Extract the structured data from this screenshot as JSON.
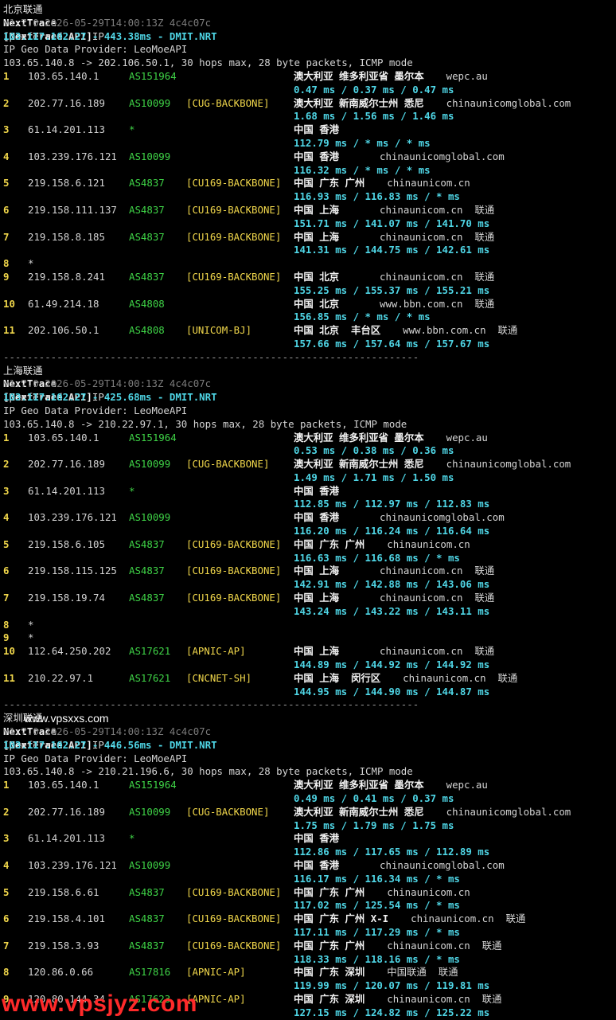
{
  "blocks": [
    {
      "title": "北京联通",
      "watermark": "",
      "version": "v1.7.0 2026-05-29T14:00:13Z 4c4c07c",
      "api_prefix": "[NextTrace API]",
      "api_mid": " preferred API IP - ",
      "api_ip": "103.117.102.27 - 443.38ms - DMIT.NRT",
      "provider": "IP Geo Data Provider: LeoMoeAPI",
      "route": "103.65.140.8 -> 202.106.50.1, 30 hops max, 28 byte packets, ICMP mode",
      "hops": [
        {
          "n": "1",
          "ip": "103.65.140.1",
          "as": "AS151964",
          "tag": "",
          "geo": "澳大利亚 维多利亚省 墨尔本",
          "dom": "wepc.au",
          "rtt": "0.47 ms / 0.37 ms / 0.47 ms"
        },
        {
          "n": "2",
          "ip": "202.77.16.189",
          "as": "AS10099",
          "tag": "[CUG-BACKBONE]",
          "geo": "澳大利亚 新南威尔士州 悉尼",
          "dom": "chinaunicomglobal.com",
          "rtt": "1.68 ms / 1.56 ms / 1.46 ms"
        },
        {
          "n": "3",
          "ip": "61.14.201.113",
          "as": "*",
          "tag": "",
          "geo": "中国 香港",
          "dom": "",
          "rtt": "112.79 ms / * ms / * ms"
        },
        {
          "n": "4",
          "ip": "103.239.176.121",
          "as": "AS10099",
          "tag": "",
          "geo": "中国 香港",
          "dom": "chinaunicomglobal.com",
          "rtt": "116.32 ms / * ms / * ms"
        },
        {
          "n": "5",
          "ip": "219.158.6.121",
          "as": "AS4837",
          "tag": "[CU169-BACKBONE]",
          "geo": "中国 广东 广州",
          "dom": "chinaunicom.cn",
          "rtt": "116.93 ms / 116.83 ms / * ms"
        },
        {
          "n": "6",
          "ip": "219.158.111.137",
          "as": "AS4837",
          "tag": "[CU169-BACKBONE]",
          "geo": "中国 上海",
          "dom": "chinaunicom.cn  联通",
          "rtt": "151.71 ms / 141.07 ms / 141.70 ms"
        },
        {
          "n": "7",
          "ip": "219.158.8.185",
          "as": "AS4837",
          "tag": "[CU169-BACKBONE]",
          "geo": "中国 上海",
          "dom": "chinaunicom.cn  联通",
          "rtt": "141.31 ms / 144.75 ms / 142.61 ms"
        },
        {
          "n": "8",
          "ip": "*",
          "as": "",
          "tag": "",
          "geo": "",
          "dom": "",
          "rtt": ""
        },
        {
          "n": "9",
          "ip": "219.158.8.241",
          "as": "AS4837",
          "tag": "[CU169-BACKBONE]",
          "geo": "中国 北京",
          "dom": "chinaunicom.cn  联通",
          "rtt": "155.25 ms / 155.37 ms / 155.21 ms"
        },
        {
          "n": "10",
          "ip": "61.49.214.18",
          "as": "AS4808",
          "tag": "",
          "geo": "中国 北京",
          "dom": "www.bbn.com.cn  联通",
          "rtt": "156.85 ms / * ms / * ms"
        },
        {
          "n": "11",
          "ip": "202.106.50.1",
          "as": "AS4808",
          "tag": "[UNICOM-BJ]",
          "geo": "中国 北京  丰台区",
          "dom": "www.bbn.com.cn  联通",
          "rtt": "157.66 ms / 157.64 ms / 157.67 ms"
        }
      ]
    },
    {
      "title": "上海联通",
      "watermark": "",
      "version": "v1.7.0 2026-05-29T14:00:13Z 4c4c07c",
      "api_prefix": "[NextTrace API]",
      "api_mid": " preferred API IP - ",
      "api_ip": "103.117.102.27 - 425.68ms - DMIT.NRT",
      "provider": "IP Geo Data Provider: LeoMoeAPI",
      "route": "103.65.140.8 -> 210.22.97.1, 30 hops max, 28 byte packets, ICMP mode",
      "hops": [
        {
          "n": "1",
          "ip": "103.65.140.1",
          "as": "AS151964",
          "tag": "",
          "geo": "澳大利亚 维多利亚省 墨尔本",
          "dom": "wepc.au",
          "rtt": "0.53 ms / 0.38 ms / 0.36 ms"
        },
        {
          "n": "2",
          "ip": "202.77.16.189",
          "as": "AS10099",
          "tag": "[CUG-BACKBONE]",
          "geo": "澳大利亚 新南威尔士州 悉尼",
          "dom": "chinaunicomglobal.com",
          "rtt": "1.49 ms / 1.71 ms / 1.50 ms"
        },
        {
          "n": "3",
          "ip": "61.14.201.113",
          "as": "*",
          "tag": "",
          "geo": "中国 香港",
          "dom": "",
          "rtt": "112.85 ms / 112.97 ms / 112.83 ms"
        },
        {
          "n": "4",
          "ip": "103.239.176.121",
          "as": "AS10099",
          "tag": "",
          "geo": "中国 香港",
          "dom": "chinaunicomglobal.com",
          "rtt": "116.20 ms / 116.24 ms / 116.64 ms"
        },
        {
          "n": "5",
          "ip": "219.158.6.105",
          "as": "AS4837",
          "tag": "[CU169-BACKBONE]",
          "geo": "中国 广东 广州",
          "dom": "chinaunicom.cn",
          "rtt": "116.63 ms / 116.68 ms / * ms"
        },
        {
          "n": "6",
          "ip": "219.158.115.125",
          "as": "AS4837",
          "tag": "[CU169-BACKBONE]",
          "geo": "中国 上海",
          "dom": "chinaunicom.cn  联通",
          "rtt": "142.91 ms / 142.88 ms / 143.06 ms"
        },
        {
          "n": "7",
          "ip": "219.158.19.74",
          "as": "AS4837",
          "tag": "[CU169-BACKBONE]",
          "geo": "中国 上海",
          "dom": "chinaunicom.cn  联通",
          "rtt": "143.24 ms / 143.22 ms / 143.11 ms"
        },
        {
          "n": "8",
          "ip": "*",
          "as": "",
          "tag": "",
          "geo": "",
          "dom": "",
          "rtt": ""
        },
        {
          "n": "9",
          "ip": "*",
          "as": "",
          "tag": "",
          "geo": "",
          "dom": "",
          "rtt": ""
        },
        {
          "n": "10",
          "ip": "112.64.250.202",
          "as": "AS17621",
          "tag": "[APNIC-AP]",
          "geo": "中国 上海",
          "dom": "chinaunicom.cn  联通",
          "rtt": "144.89 ms / 144.92 ms / 144.92 ms"
        },
        {
          "n": "11",
          "ip": "210.22.97.1",
          "as": "AS17621",
          "tag": "[CNCNET-SH]",
          "geo": "中国 上海  闵行区",
          "dom": "chinaunicom.cn  联通",
          "rtt": "144.95 ms / 144.90 ms / 144.87 ms"
        }
      ]
    },
    {
      "title": "深圳联通",
      "watermark": "www.vpsxxs.com",
      "version": "v1.7.0 2026-05-29T14:00:13Z 4c4c07c",
      "api_prefix": "[NextTrace API]",
      "api_mid": " preferred API IP - ",
      "api_ip": "103.117.102.27 - 446.56ms - DMIT.NRT",
      "provider": "IP Geo Data Provider: LeoMoeAPI",
      "route": "103.65.140.8 -> 210.21.196.6, 30 hops max, 28 byte packets, ICMP mode",
      "hops": [
        {
          "n": "1",
          "ip": "103.65.140.1",
          "as": "AS151964",
          "tag": "",
          "geo": "澳大利亚 维多利亚省 墨尔本",
          "dom": "wepc.au",
          "rtt": "0.49 ms / 0.41 ms / 0.37 ms"
        },
        {
          "n": "2",
          "ip": "202.77.16.189",
          "as": "AS10099",
          "tag": "[CUG-BACKBONE]",
          "geo": "澳大利亚 新南威尔士州 悉尼",
          "dom": "chinaunicomglobal.com",
          "rtt": "1.75 ms / 1.79 ms / 1.75 ms"
        },
        {
          "n": "3",
          "ip": "61.14.201.113",
          "as": "*",
          "tag": "",
          "geo": "中国 香港",
          "dom": "",
          "rtt": "112.86 ms / 117.65 ms / 112.89 ms"
        },
        {
          "n": "4",
          "ip": "103.239.176.121",
          "as": "AS10099",
          "tag": "",
          "geo": "中国 香港",
          "dom": "chinaunicomglobal.com",
          "rtt": "116.17 ms / 116.34 ms / * ms"
        },
        {
          "n": "5",
          "ip": "219.158.6.61",
          "as": "AS4837",
          "tag": "[CU169-BACKBONE]",
          "geo": "中国 广东 广州",
          "dom": "chinaunicom.cn",
          "rtt": "117.02 ms / 125.54 ms / * ms"
        },
        {
          "n": "6",
          "ip": "219.158.4.101",
          "as": "AS4837",
          "tag": "[CU169-BACKBONE]",
          "geo": "中国 广东 广州 X-I",
          "dom": "chinaunicom.cn  联通",
          "rtt": "117.11 ms / 117.29 ms / * ms"
        },
        {
          "n": "7",
          "ip": "219.158.3.93",
          "as": "AS4837",
          "tag": "[CU169-BACKBONE]",
          "geo": "中国 广东 广州",
          "dom": "chinaunicom.cn  联通",
          "rtt": "118.33 ms / 118.16 ms / * ms"
        },
        {
          "n": "8",
          "ip": "120.86.0.66",
          "as": "AS17816",
          "tag": "[APNIC-AP]",
          "geo": "中国 广东 深圳",
          "dom": "中国联通  联通",
          "rtt": "119.99 ms / 120.07 ms / 119.81 ms"
        },
        {
          "n": "9",
          "ip": "120.80.144.34",
          "as": "AS17623",
          "tag": "[APNIC-AP]",
          "geo": "中国 广东 深圳",
          "dom": "chinaunicom.cn  联通",
          "rtt": "127.15 ms / 124.82 ms / 125.22 ms"
        }
      ]
    }
  ],
  "separator": "----------------------------------------------------------------------",
  "bottom_watermark": "www.vpsjyz.com",
  "colors": {
    "cyan": "#4fd6e6",
    "yellow": "#f1d74b",
    "green": "#3fd447",
    "watermark_red": "#ff2a2a"
  }
}
